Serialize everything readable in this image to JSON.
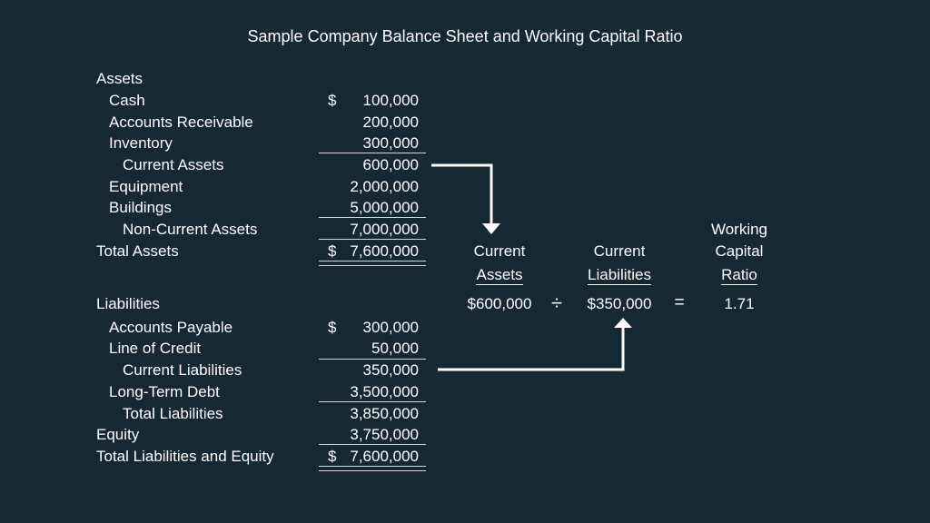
{
  "title": "Sample Company Balance Sheet and Working Capital Ratio",
  "assets": {
    "heading": "Assets",
    "rows": [
      {
        "label": "Cash",
        "currency": "$",
        "value": "100,000"
      },
      {
        "label": "Accounts Receivable",
        "currency": "",
        "value": "200,000"
      },
      {
        "label": "Inventory",
        "currency": "",
        "value": "300,000"
      },
      {
        "label": "Current Assets",
        "currency": "",
        "value": "600,000"
      },
      {
        "label": "Equipment",
        "currency": "",
        "value": "2,000,000"
      },
      {
        "label": "Buildings",
        "currency": "",
        "value": "5,000,000"
      },
      {
        "label": "Non-Current Assets",
        "currency": "",
        "value": "7,000,000"
      },
      {
        "label": "Total Assets",
        "currency": "$",
        "value": "7,600,000"
      }
    ]
  },
  "liabilities": {
    "heading": "Liabilities",
    "rows": [
      {
        "label": "Accounts Payable",
        "currency": "$",
        "value": "300,000"
      },
      {
        "label": "Line of Credit",
        "currency": "",
        "value": "50,000"
      },
      {
        "label": "Current Liabilities",
        "currency": "",
        "value": "350,000"
      },
      {
        "label": "Long-Term Debt",
        "currency": "",
        "value": "3,500,000"
      },
      {
        "label": "Total Liabilities",
        "currency": "",
        "value": "3,850,000"
      },
      {
        "label": "Equity",
        "currency": "",
        "value": "3,750,000"
      },
      {
        "label": "Total Liabilities and Equity",
        "currency": "$",
        "value": "7,600,000"
      }
    ]
  },
  "ratio": {
    "current_assets": {
      "line1": "Current",
      "line2": "Assets",
      "value": "$600,000"
    },
    "current_liabilities": {
      "line1": "Current",
      "line2": "Liabilities",
      "value": "$350,000"
    },
    "result": {
      "line0": "Working",
      "line1": "Capital",
      "line2": "Ratio",
      "value": "1.71"
    },
    "divide_symbol": "÷",
    "equals_symbol": "="
  }
}
